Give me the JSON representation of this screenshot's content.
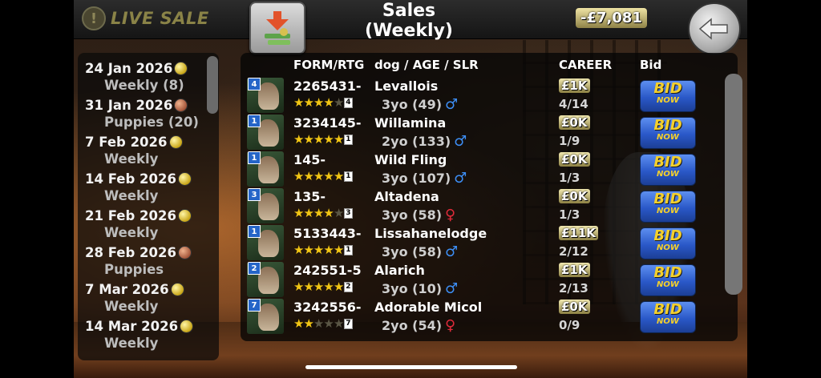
{
  "header": {
    "live_sale_label": "LIVE SALE",
    "title": "Sales (Weekly)",
    "balance": "-£7,081"
  },
  "dates": [
    {
      "date": "24 Jan 2026",
      "coin": "gold",
      "type": "Weekly (8)"
    },
    {
      "date": "31 Jan 2026",
      "coin": "bronze",
      "type": "Puppies (20)"
    },
    {
      "date": "7 Feb 2026",
      "coin": "gold",
      "type": "Weekly"
    },
    {
      "date": "14 Feb 2026",
      "coin": "gold",
      "type": "Weekly"
    },
    {
      "date": "21 Feb 2026",
      "coin": "gold",
      "type": "Weekly"
    },
    {
      "date": "28 Feb 2026",
      "coin": "bronze",
      "type": "Puppies"
    },
    {
      "date": "7 Mar 2026",
      "coin": "gold",
      "type": "Weekly"
    },
    {
      "date": "14 Mar 2026",
      "coin": "gold",
      "type": "Weekly"
    }
  ],
  "columns": {
    "form": "FORM/RTG",
    "dog": "dog / AGE / SLR",
    "career": "CAREER",
    "bid": "Bid"
  },
  "dogs": [
    {
      "trap": "4",
      "form": "2265431-",
      "stars": 3.5,
      "rtg": "4",
      "name": "Levallois",
      "age": "3yo (49)",
      "sex": "male",
      "price": "£1K",
      "career": "4/14"
    },
    {
      "trap": "1",
      "form": "3234145-",
      "stars": 5,
      "rtg": "1",
      "name": "Willamina",
      "age": "2yo (133)",
      "sex": "male",
      "price": "£0K",
      "career": "1/9"
    },
    {
      "trap": "1",
      "form": "145-",
      "stars": 5,
      "rtg": "1",
      "name": "Wild Fling",
      "age": "3yo (107)",
      "sex": "male",
      "price": "£0K",
      "career": "1/3"
    },
    {
      "trap": "3",
      "form": "135-",
      "stars": 4,
      "rtg": "3",
      "name": "Altadena",
      "age": "3yo (58)",
      "sex": "female",
      "price": "£0K",
      "career": "1/3"
    },
    {
      "trap": "1",
      "form": "5133443-",
      "stars": 5,
      "rtg": "1",
      "name": "Lissahanelodge",
      "age": "3yo (58)",
      "sex": "male",
      "price": "£11K",
      "career": "2/12"
    },
    {
      "trap": "2",
      "form": "242551-5",
      "stars": 4.5,
      "rtg": "2",
      "name": "Alarich",
      "age": "3yo (10)",
      "sex": "male",
      "price": "£1K",
      "career": "2/13"
    },
    {
      "trap": "7",
      "form": "3242556-",
      "stars": 2,
      "rtg": "7",
      "name": "Adorable Micol",
      "age": "2yo (54)",
      "sex": "female",
      "price": "£0K",
      "career": "0/9"
    }
  ],
  "bid_label": {
    "top": "BID",
    "bottom": "NOW"
  },
  "icons": {
    "warning": "warning-icon",
    "sort": "sort-arrow-icon",
    "back": "back-arrow-icon",
    "male": "♂",
    "female": "♀"
  },
  "colors": {
    "star_on": "#f2c614",
    "bid_blue": "#2a58c8",
    "male": "#3d8ef5",
    "female": "#e02b3a"
  }
}
